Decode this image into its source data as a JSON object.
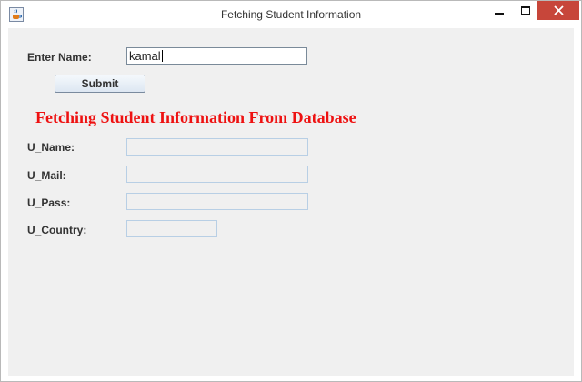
{
  "window": {
    "title": "Fetching Student Information",
    "icon": "java-cup-icon",
    "controls": {
      "minimize_icon": "minimize-icon",
      "maximize_icon": "maximize-icon",
      "close_icon": "close-icon"
    },
    "close_color": "#c7463a"
  },
  "form": {
    "name_label": "Enter Name:",
    "name_value": "kamal",
    "submit_label": "Submit"
  },
  "heading": {
    "text": "Fetching Student Information From Database",
    "color": "#ee1111"
  },
  "fields": [
    {
      "label": "U_Name:",
      "value": ""
    },
    {
      "label": "U_Mail:",
      "value": ""
    },
    {
      "label": "U_Pass:",
      "value": ""
    },
    {
      "label": "U_Country:",
      "value": ""
    }
  ]
}
